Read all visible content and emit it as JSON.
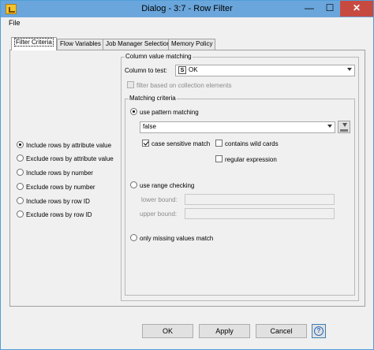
{
  "window": {
    "title": "Dialog - 3:7 - Row Filter",
    "minimize_glyph": "—",
    "maximize_glyph": "☐",
    "close_glyph": "✕"
  },
  "menu": {
    "file": "File"
  },
  "tabs": [
    {
      "label": "Filter Criteria",
      "active": true
    },
    {
      "label": "Flow Variables"
    },
    {
      "label": "Job Manager Selection"
    },
    {
      "label": "Memory Policy"
    }
  ],
  "row_options": [
    {
      "label": "Include rows by attribute value",
      "selected": true
    },
    {
      "label": "Exclude rows by attribute value"
    },
    {
      "label": "Include rows by number"
    },
    {
      "label": "Exclude rows by number"
    },
    {
      "label": "Include rows by row ID"
    },
    {
      "label": "Exclude rows by row ID"
    }
  ],
  "column_value_matching": {
    "group_label": "Column value matching",
    "column_to_test_label": "Column to test:",
    "column_type_badge": "S",
    "column_value": "OK",
    "collection_filter_label": "filter based on collection elements"
  },
  "matching_criteria": {
    "group_label": "Matching criteria",
    "pattern_label": "use pattern matching",
    "pattern_value": "false",
    "case_sensitive_label": "case sensitive match",
    "wildcards_label": "contains wild cards",
    "regex_label": "regular expression",
    "range_label": "use range checking",
    "lower_bound_label": "lower bound:",
    "upper_bound_label": "upper bound:",
    "missing_label": "only missing values match"
  },
  "buttons": {
    "ok": "OK",
    "apply": "Apply",
    "cancel": "Cancel",
    "help": "?"
  },
  "colors": {
    "titlebar": "#6aa6dc",
    "close": "#c74a41",
    "accent": "#2a6ac2"
  }
}
